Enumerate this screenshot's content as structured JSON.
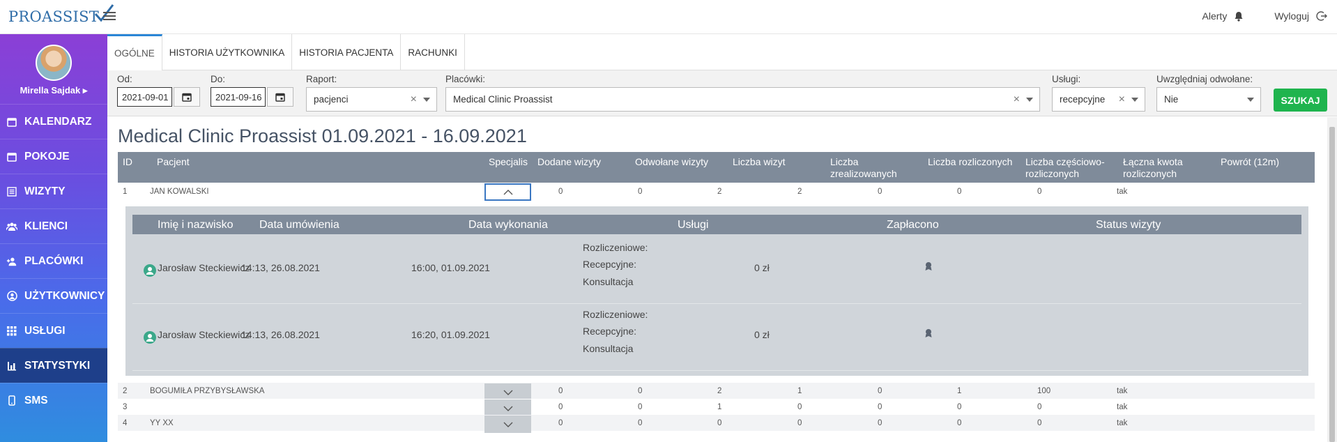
{
  "brand": {
    "logo_text": "PROASSIST"
  },
  "topbar": {
    "alerts": "Alerty",
    "logout": "Wyloguj"
  },
  "user": {
    "name": "Mirella Sajdak ▸"
  },
  "nav": [
    {
      "label": "KALENDARZ",
      "icon": "calendar-icon"
    },
    {
      "label": "POKOJE",
      "icon": "calendar-icon"
    },
    {
      "label": "WIZYTY",
      "icon": "list-icon"
    },
    {
      "label": "KLIENCI",
      "icon": "users-icon"
    },
    {
      "label": "PLACÓWKI",
      "icon": "add-user-icon"
    },
    {
      "label": "UŻYTKOWNICY",
      "icon": "user-circle-icon"
    },
    {
      "label": "USŁUGI",
      "icon": "grid-icon"
    },
    {
      "label": "STATYSTYKI",
      "icon": "bar-chart-icon",
      "active": true
    },
    {
      "label": "SMS",
      "icon": "phone-icon"
    }
  ],
  "tabs": [
    "OGÓLNE",
    "HISTORIA UŻYTKOWNIKA",
    "HISTORIA PACJENTA",
    "RACHUNKI"
  ],
  "filters": {
    "od_label": "Od:",
    "od_value": "2021-09-01",
    "do_label": "Do:",
    "do_value": "2021-09-16",
    "raport_label": "Raport:",
    "raport_value": "pacjenci",
    "placowki_label": "Placówki:",
    "placowki_value": "Medical Clinic Proassist",
    "uslugi_label": "Usługi:",
    "uslugi_value": "recepcyjne",
    "odwolane_label": "Uwzględniaj odwołane:",
    "odwolane_value": "Nie",
    "search_button": "SZUKAJ"
  },
  "report_title": "Medical Clinic Proassist 01.09.2021 - 16.09.2021",
  "columns": [
    "ID",
    "Pacjent",
    "Specjalis",
    "Dodane wizyty",
    "Odwołane wizyty",
    "Liczba wizyt",
    "Liczba zrealizowanych",
    "Liczba rozliczonych",
    "Liczba częściowo-rozliczonych",
    "Łączna kwota rozliczonych",
    "Powrót (12m)"
  ],
  "rows": [
    {
      "id": "1",
      "patient": "JAN KOWALSKI",
      "added": "0",
      "cancelled": "0",
      "visits": "2",
      "realized": "2",
      "settled": "0",
      "partial": "0",
      "amount": "0",
      "return": "tak"
    },
    {
      "id": "2",
      "patient": "BOGUMIŁA PRZYBYSŁAWSKA",
      "added": "0",
      "cancelled": "0",
      "visits": "2",
      "realized": "1",
      "settled": "0",
      "partial": "1",
      "amount": "100",
      "return": "tak"
    },
    {
      "id": "3",
      "patient": "",
      "added": "0",
      "cancelled": "0",
      "visits": "1",
      "realized": "0",
      "settled": "0",
      "partial": "0",
      "amount": "0",
      "return": "tak"
    },
    {
      "id": "4",
      "patient": "YY XX",
      "added": "0",
      "cancelled": "0",
      "visits": "0",
      "realized": "0",
      "settled": "0",
      "partial": "0",
      "amount": "0",
      "return": "tak"
    }
  ],
  "detail": {
    "columns": [
      "Imię i nazwisko",
      "Data umówienia",
      "Data wykonania",
      "Usługi",
      "Zapłacono",
      "Status wizyty"
    ],
    "visits": [
      {
        "name": "Jarosław Steckiewicz",
        "booked": "14:13, 26.08.2021",
        "done": "16:00, 01.09.2021",
        "svc1": "Rozliczeniowe:",
        "svc2": "Recepcyjne:",
        "svc3": "Konsultacja",
        "paid": "0 zł"
      },
      {
        "name": "Jarosław Steckiewicz",
        "booked": "14:13, 26.08.2021",
        "done": "16:20, 01.09.2021",
        "svc1": "Rozliczeniowe:",
        "svc2": "Recepcyjne:",
        "svc3": "Konsultacja",
        "paid": "0 zł"
      }
    ]
  }
}
